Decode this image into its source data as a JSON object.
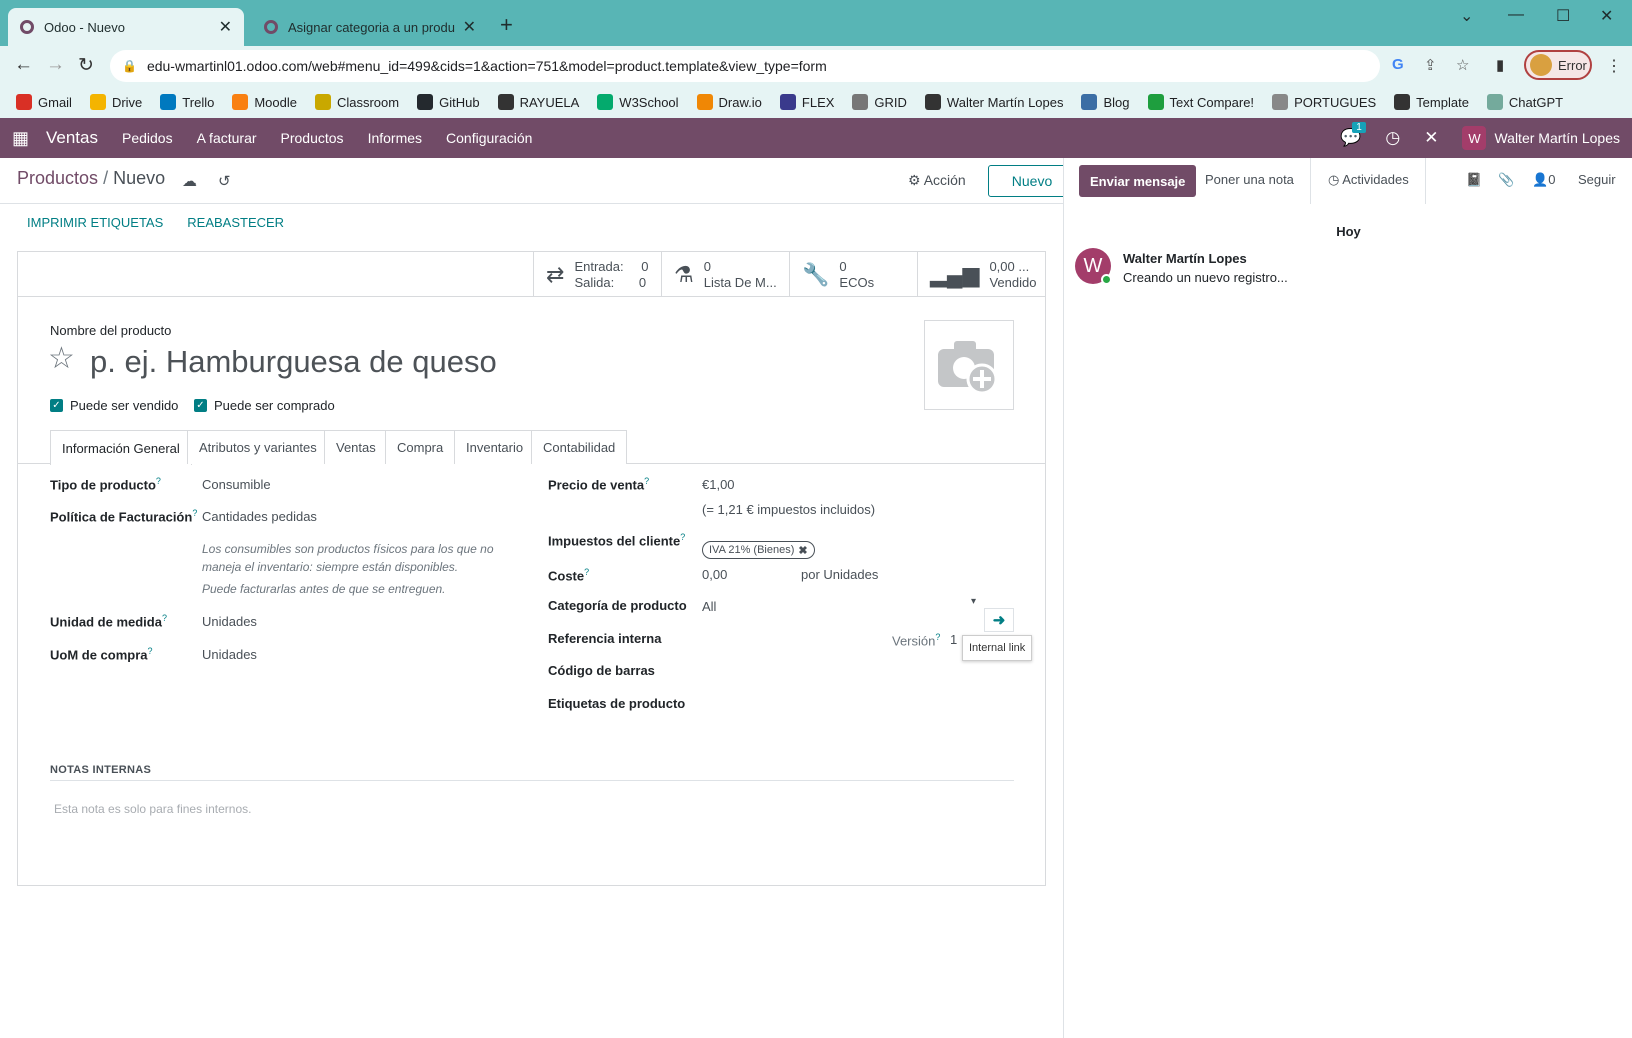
{
  "browser": {
    "tabs": [
      {
        "title": "Odoo - Nuevo"
      },
      {
        "title": "Asignar categoria a un producto"
      }
    ],
    "url": "edu-wmartinl01.odoo.com/web#menu_id=499&cids=1&action=751&model=product.template&view_type=form",
    "profile_status": "Error",
    "bookmarks": [
      {
        "label": "Gmail",
        "icon": "gmail-icon",
        "color": "#d93025"
      },
      {
        "label": "Drive",
        "icon": "drive-icon",
        "color": "#f4b400"
      },
      {
        "label": "Trello",
        "icon": "trello-icon",
        "color": "#0079bf"
      },
      {
        "label": "Moodle",
        "icon": "moodle-icon",
        "color": "#f98012"
      },
      {
        "label": "Classroom",
        "icon": "classroom-icon",
        "color": "#c9a800"
      },
      {
        "label": "GitHub",
        "icon": "github-icon",
        "color": "#24292e"
      },
      {
        "label": "RAYUELA",
        "icon": "globe-icon",
        "color": "#333333"
      },
      {
        "label": "W3School",
        "icon": "w3school-icon",
        "color": "#04aa6d"
      },
      {
        "label": "Draw.io",
        "icon": "drawio-icon",
        "color": "#f08705"
      },
      {
        "label": "FLEX",
        "icon": "flex-icon",
        "color": "#3a3a8c"
      },
      {
        "label": "GRID",
        "icon": "grid-icon",
        "color": "#777777"
      },
      {
        "label": "Walter Martín Lopes",
        "icon": "globe-icon",
        "color": "#333333"
      },
      {
        "label": "Blog",
        "icon": "blog-icon",
        "color": "#3b6ea5"
      },
      {
        "label": "Text Compare!",
        "icon": "textcompare-icon",
        "color": "#1e9e3e"
      },
      {
        "label": "PORTUGUES",
        "icon": "doc-icon",
        "color": "#888888"
      },
      {
        "label": "Template",
        "icon": "globe-icon",
        "color": "#333333"
      },
      {
        "label": "ChatGPT",
        "icon": "chatgpt-icon",
        "color": "#74aa9c"
      }
    ]
  },
  "odoo_nav": {
    "app": "Ventas",
    "menu": [
      "Pedidos",
      "A facturar",
      "Productos",
      "Informes",
      "Configuración"
    ],
    "messages_badge": "1",
    "user": "Walter Martín Lopes",
    "user_initial": "W"
  },
  "control_panel": {
    "breadcrumb_parent": "Productos",
    "breadcrumb_current": "Nuevo",
    "action_label": "Acción",
    "new_button": "Nuevo",
    "buttons": [
      "IMPRIMIR ETIQUETAS",
      "REABASTECER"
    ]
  },
  "stat_buttons": {
    "moves": {
      "in_label": "Entrada:",
      "in_value": "0",
      "out_label": "Salida:",
      "out_value": "0"
    },
    "bom": {
      "value": "0",
      "label": "Lista De M..."
    },
    "ecos": {
      "value": "0",
      "label": "ECOs"
    },
    "sold": {
      "value": "0,00 ...",
      "label": "Vendido"
    }
  },
  "form": {
    "name_label": "Nombre del producto",
    "name_placeholder": "p. ej. Hamburguesa de queso",
    "can_be_sold": "Puede ser vendido",
    "can_be_purchased": "Puede ser comprado",
    "tabs": [
      "Información General",
      "Atributos y variantes",
      "Ventas",
      "Compra",
      "Inventario",
      "Contabilidad"
    ],
    "left": {
      "type_label": "Tipo de producto",
      "type_value": "Consumible",
      "invoice_policy_label": "Política de Facturación",
      "invoice_policy_value": "Cantidades pedidas",
      "help1": "Los consumibles son productos físicos para los que no maneja el inventario: siempre están disponibles.",
      "help2": "Puede facturarlas antes de que se entreguen.",
      "uom_label": "Unidad de medida",
      "uom_value": "Unidades",
      "uom_po_label": "UoM de compra",
      "uom_po_value": "Unidades"
    },
    "right": {
      "price_label": "Precio de venta",
      "price_value": "€1,00",
      "price_taxed": "(= 1,21 € impuestos incluidos)",
      "taxes_label": "Impuestos del cliente",
      "tax_tag": "IVA 21% (Bienes)",
      "cost_label": "Coste",
      "cost_value": "0,00",
      "cost_per": "por Unidades",
      "category_label": "Categoría de producto",
      "category_value": "All",
      "tooltip": "Internal link",
      "ref_label": "Referencia interna",
      "version_label": "Versión",
      "version_value": "1",
      "barcode_label": "Código de barras",
      "tags_label": "Etiquetas de producto"
    },
    "notes_title": "NOTAS INTERNAS",
    "notes_placeholder": "Esta nota es solo para fines internos."
  },
  "chatter": {
    "send_message": "Enviar mensaje",
    "log_note": "Poner una nota",
    "activities": "Actividades",
    "followers_count": "0",
    "follow": "Seguir",
    "day": "Hoy",
    "message_author": "Walter Martín Lopes",
    "message_body": "Creando un nuevo registro...",
    "author_initial": "W"
  }
}
